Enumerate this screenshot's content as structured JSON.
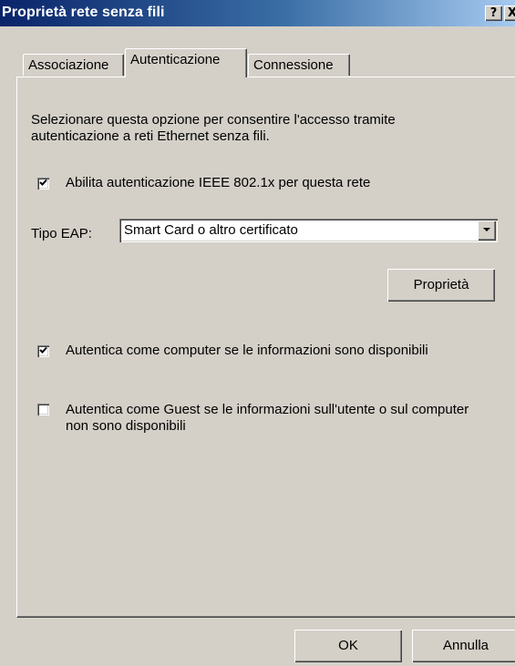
{
  "window": {
    "title": "Proprietà rete senza fili",
    "help_button": "?",
    "close_button": "X"
  },
  "tabs": [
    {
      "label": "Associazione",
      "active": false
    },
    {
      "label": "Autenticazione",
      "active": true
    },
    {
      "label": "Connessione",
      "active": false
    }
  ],
  "content": {
    "description": "Selezionare questa opzione per consentire l'accesso tramite autenticazione a reti Ethernet senza fili.",
    "enable_8021x": {
      "label": "Abilita autenticazione IEEE 802.1x per questa rete",
      "checked": true
    },
    "eap_label": "Tipo EAP:",
    "eap_value": "Smart Card o altro certificato",
    "properties_button": "Proprietà",
    "auth_computer": {
      "label": "Autentica come computer se le informazioni sono disponibili",
      "checked": true
    },
    "auth_guest": {
      "label": "Autentica come Guest se le informazioni sull'utente o sul computer non sono disponibili",
      "checked": false
    }
  },
  "footer": {
    "ok_label": "OK",
    "cancel_label": "Annulla"
  }
}
